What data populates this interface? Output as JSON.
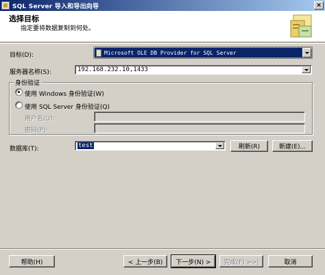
{
  "window": {
    "title": "SQL Server 导入和导出向导",
    "close_label": "×"
  },
  "header": {
    "title": "选择目标",
    "subtitle": "指定要将数据复制到何处。",
    "icon": "wizard-icon"
  },
  "destination": {
    "label": "目标(D):",
    "value": "Microsoft OLE DB Provider for SQL Server"
  },
  "server": {
    "label": "服务器名称(S):",
    "value": "192.168.232.10,1433"
  },
  "auth": {
    "legend": "身份验证",
    "windows_label": "使用 Windows 身份验证(W)",
    "sql_label": "使用 SQL Server 身份验证(Q)",
    "selected": "windows",
    "username_label": "用户名(U):",
    "password_label": "密码(P):"
  },
  "database": {
    "label": "数据库(T):",
    "value": "test",
    "refresh_label": "刷新(R)",
    "new_label": "新建(E)..."
  },
  "footer": {
    "help_label": "帮助(H)",
    "back_label": "< 上一步(B)",
    "next_label": "下一步(N) >",
    "finish_label": "完成(F) >>|",
    "cancel_label": "取消"
  }
}
